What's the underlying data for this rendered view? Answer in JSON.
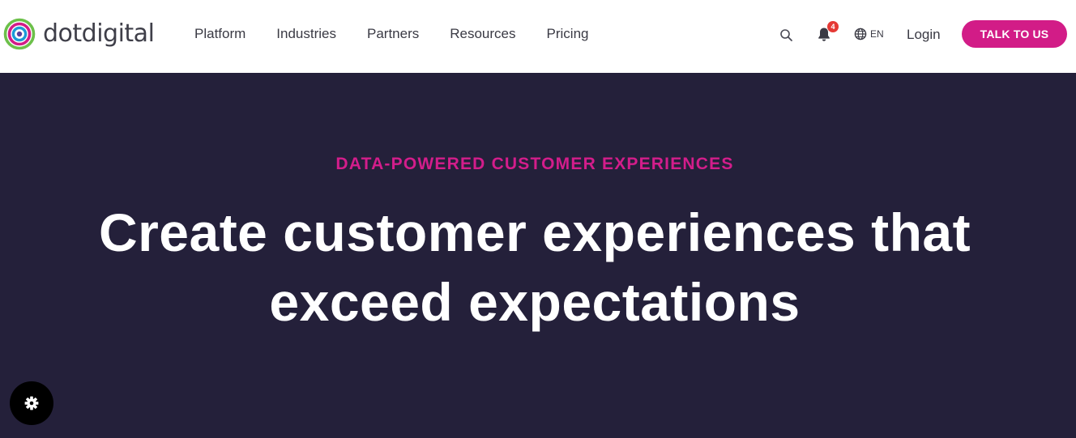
{
  "brand": {
    "name": "dotdigital",
    "logo_icon": "concentric-rings-logo-icon",
    "colors": {
      "green": "#6cc04a",
      "magenta": "#d21c87",
      "blue": "#1b9bd7",
      "purple": "#5b3f9e"
    }
  },
  "nav": {
    "items": [
      {
        "label": "Platform"
      },
      {
        "label": "Industries"
      },
      {
        "label": "Partners"
      },
      {
        "label": "Resources"
      },
      {
        "label": "Pricing"
      }
    ]
  },
  "utility": {
    "search_icon": "search-icon",
    "notifications": {
      "icon": "bell-icon",
      "count": "4"
    },
    "language": {
      "icon": "globe-icon",
      "label": "EN"
    },
    "login_label": "Login",
    "cta_label": "TALK TO US"
  },
  "hero": {
    "eyebrow": "DATA-POWERED CUSTOMER EXPERIENCES",
    "headline_line1": "Create customer experiences that",
    "headline_line2": "exceed expectations",
    "background_color": "#24203a",
    "eyebrow_color": "#d31d8b"
  },
  "floating": {
    "settings_icon": "gear-icon"
  }
}
